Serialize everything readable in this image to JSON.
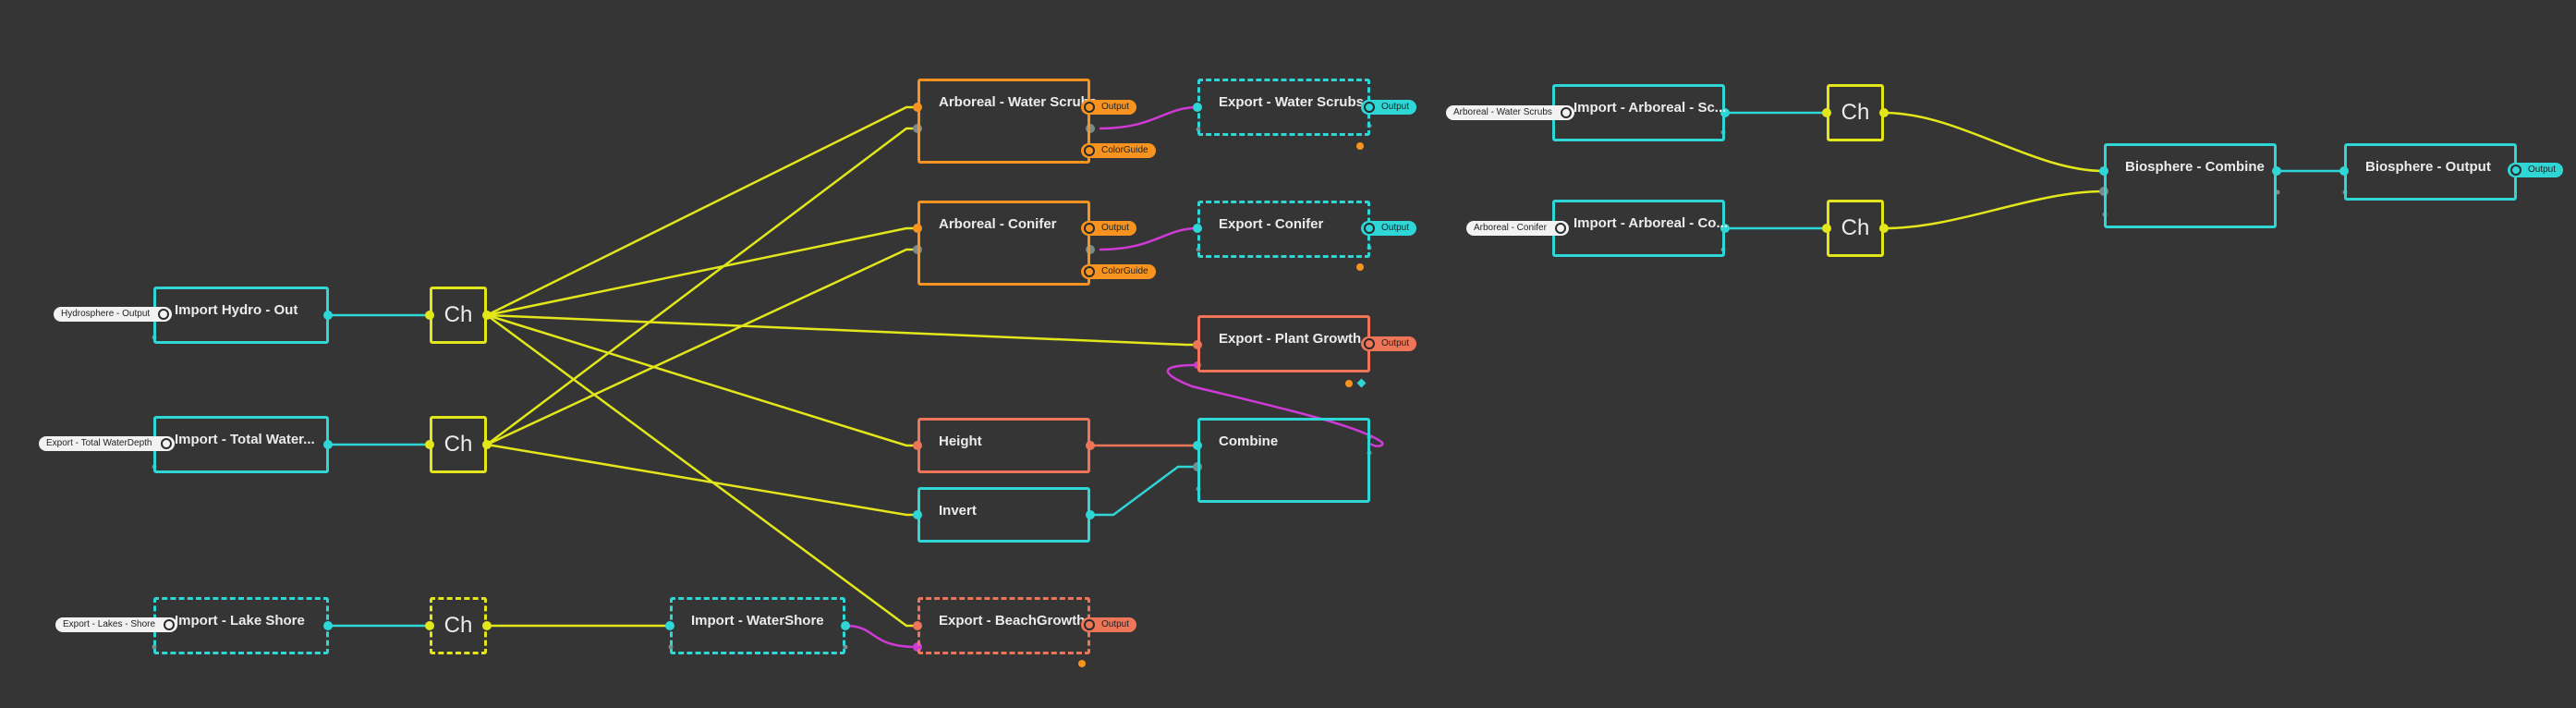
{
  "colors": {
    "background": "#353535",
    "cyan": "#2fd6d6",
    "yellow": "#e2e61a",
    "orange": "#f7931e",
    "salmon": "#ef7558",
    "magenta": "#d03ad6",
    "gray": "#7a8a8a",
    "text": "#ececec"
  },
  "nodes": {
    "import_hydro_out": {
      "title": "Import Hydro - Out",
      "source": "Hydrosphere - Output"
    },
    "import_total_water": {
      "title": "Import - Total Water...",
      "source": "Export - Total WaterDepth"
    },
    "import_lake_shore": {
      "title": "Import - Lake Shore",
      "source": "Export - Lakes - Shore"
    },
    "ch1": {
      "title": "Ch"
    },
    "ch2": {
      "title": "Ch"
    },
    "ch3": {
      "title": "Ch"
    },
    "ch4": {
      "title": "Ch"
    },
    "ch5": {
      "title": "Ch"
    },
    "import_watershore": {
      "title": "Import - WaterShore"
    },
    "arboreal_water_scrubs": {
      "title": "Arboreal - Water Scrubs",
      "output": "Output",
      "colorguide": "ColorGuide"
    },
    "arboreal_conifer": {
      "title": "Arboreal - Conifer",
      "output": "Output",
      "colorguide": "ColorGuide"
    },
    "height": {
      "title": "Height"
    },
    "invert": {
      "title": "Invert"
    },
    "export_beachgrowth": {
      "title": "Export - BeachGrowth",
      "output": "Output"
    },
    "export_water_scrubs": {
      "title": "Export - Water Scrubs",
      "output": "Output"
    },
    "export_conifer": {
      "title": "Export - Conifer",
      "output": "Output"
    },
    "export_plant_growth": {
      "title": "Export - Plant Growth",
      "output": "Output"
    },
    "combine": {
      "title": "Combine"
    },
    "import_arboreal_scrubs": {
      "title": "Import - Arboreal - Sc...",
      "source": "Arboreal - Water Scrubs"
    },
    "import_arboreal_conifer": {
      "title": "Import - Arboreal - Co...",
      "source": "Arboreal - Conifer"
    },
    "biosphere_combine": {
      "title": "Biosphere - Combine"
    },
    "biosphere_output": {
      "title": "Biosphere - Output",
      "output": "Output"
    }
  }
}
